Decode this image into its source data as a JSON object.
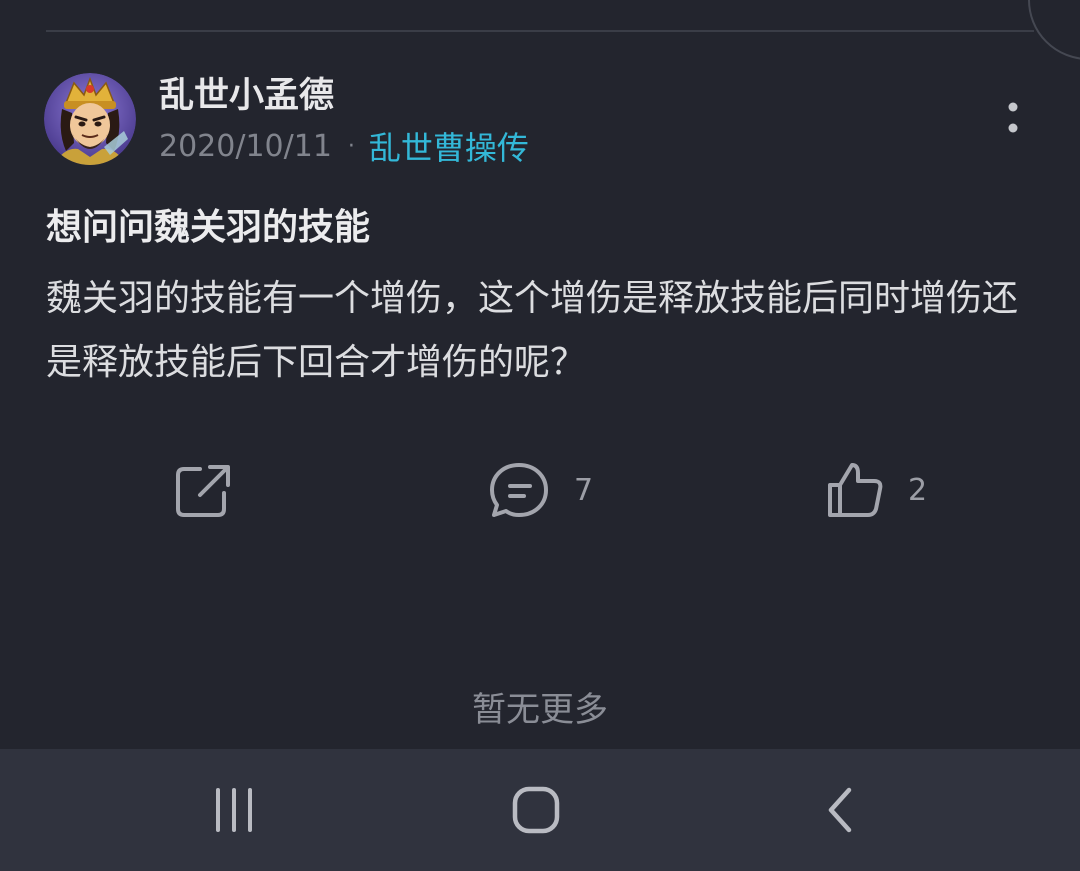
{
  "post": {
    "author": {
      "name": "乱世小孟德",
      "avatar_icon": "warlord-portrait-avatar"
    },
    "date": "2020/10/11",
    "meta_separator": "·",
    "board": "乱世曹操传",
    "title": "想问问魏关羽的技能",
    "body": "魏关羽的技能有一个增伤，这个增伤是释放技能后同时增伤还是释放技能后下回合才增伤的呢？",
    "actions": {
      "share_icon": "share-icon",
      "comment_icon": "comment-icon",
      "comment_count": "7",
      "like_icon": "thumbs-up-icon",
      "like_count": "2"
    }
  },
  "footer": {
    "no_more": "暂无更多"
  },
  "nav_bar": {
    "recent_icon": "recent-apps-icon",
    "home_icon": "home-icon",
    "back_icon": "back-icon"
  },
  "colors": {
    "background": "#23252e",
    "accent": "#33b8d8",
    "nav_bar": "#30333e"
  }
}
